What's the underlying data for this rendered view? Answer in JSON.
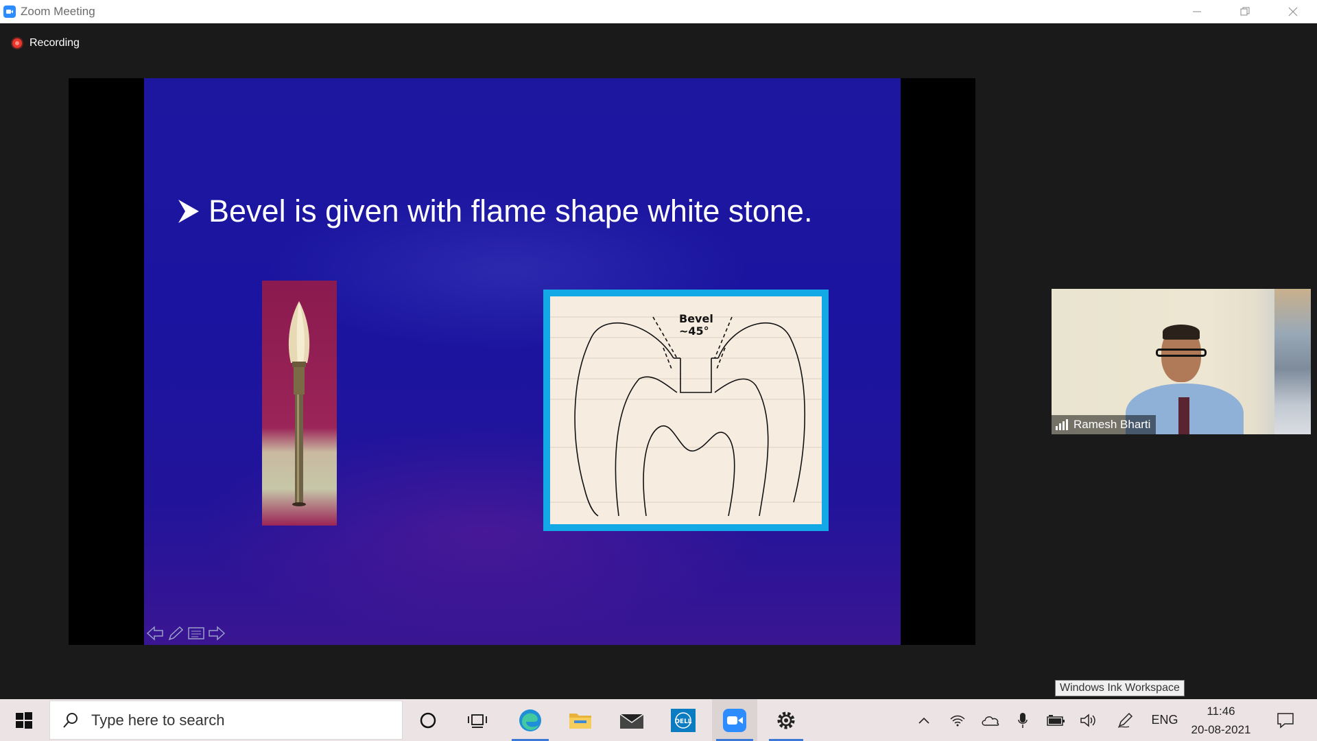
{
  "window": {
    "title": "Zoom Meeting"
  },
  "meeting": {
    "recording_label": "Recording"
  },
  "slide": {
    "title": "Bevel is given with flame shape white stone.",
    "diagram_label_1": "Bevel",
    "diagram_label_2": "~45°"
  },
  "participant": {
    "name": "Ramesh Bharti"
  },
  "tooltip": {
    "text": "Windows Ink Workspace"
  },
  "taskbar": {
    "search_placeholder": "Type here to search",
    "language": "ENG",
    "time": "11:46",
    "date": "20-08-2021",
    "accent_color": "#3b78d8"
  },
  "colors": {
    "slide_background": "#1d17a0",
    "diagram_frame": "#13a9e6",
    "recording_dot": "#e8362d",
    "zoom_blue": "#2d8cff"
  },
  "icons": {
    "title_app": "zoom-icon",
    "taskbar": [
      "windows-start-icon",
      "search-icon",
      "cortana-icon",
      "task-view-icon",
      "edge-icon",
      "file-explorer-icon",
      "mail-icon",
      "dell-icon",
      "zoom-icon",
      "settings-icon"
    ],
    "tray": [
      "chevron-up-icon",
      "wifi-icon",
      "onedrive-icon",
      "microphone-icon",
      "battery-icon",
      "volume-icon",
      "pen-icon",
      "notification-icon"
    ]
  }
}
